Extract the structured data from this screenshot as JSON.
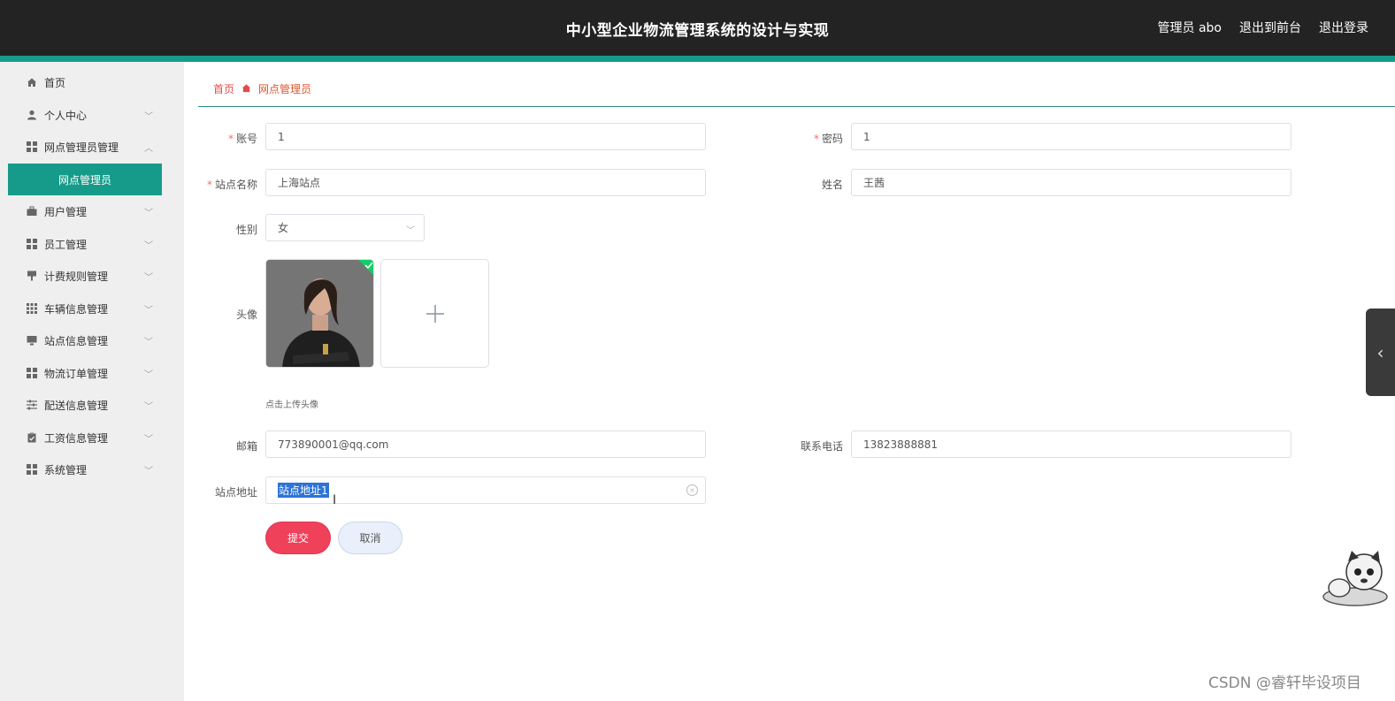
{
  "header": {
    "title": "中小型企业物流管理系统的设计与实现",
    "user": "管理员 abo",
    "to_front": "退出到前台",
    "logout": "退出登录"
  },
  "sidebar": {
    "items": [
      {
        "label": "首页",
        "icon": "home-icon"
      },
      {
        "label": "个人中心",
        "icon": "user-icon"
      },
      {
        "label": "网点管理员管理",
        "icon": "grid-icon"
      },
      {
        "label": "用户管理",
        "icon": "briefcase-icon"
      },
      {
        "label": "员工管理",
        "icon": "grid-icon"
      },
      {
        "label": "计费规则管理",
        "icon": "pin-icon"
      },
      {
        "label": "车辆信息管理",
        "icon": "grid-dots-icon"
      },
      {
        "label": "站点信息管理",
        "icon": "monitor-icon"
      },
      {
        "label": "物流订单管理",
        "icon": "grid-icon"
      },
      {
        "label": "配送信息管理",
        "icon": "sliders-icon"
      },
      {
        "label": "工资信息管理",
        "icon": "clipboard-icon"
      },
      {
        "label": "系统管理",
        "icon": "grid-icon"
      }
    ],
    "active_sub": "网点管理员"
  },
  "breadcrumb": {
    "home": "首页",
    "current": "网点管理员"
  },
  "form": {
    "account": {
      "label": "账号",
      "value": "1"
    },
    "password": {
      "label": "密码",
      "value": "1"
    },
    "station_name": {
      "label": "站点名称",
      "value": "上海站点"
    },
    "name": {
      "label": "姓名",
      "value": "王茜"
    },
    "gender": {
      "label": "性别",
      "value": "女"
    },
    "avatar": {
      "label": "头像",
      "hint": "点击上传头像"
    },
    "email": {
      "label": "邮箱",
      "value": "773890001@qq.com"
    },
    "phone": {
      "label": "联系电话",
      "value": "13823888881"
    },
    "address": {
      "label": "站点地址",
      "value": "站点地址1"
    },
    "submit": "提交",
    "cancel": "取消"
  },
  "watermark": "CSDN @睿轩毕设项目",
  "colors": {
    "header_bg": "#232323",
    "accent": "#169b8a",
    "submit": "#f0415a",
    "breadcrumb": "#e64a4a"
  }
}
